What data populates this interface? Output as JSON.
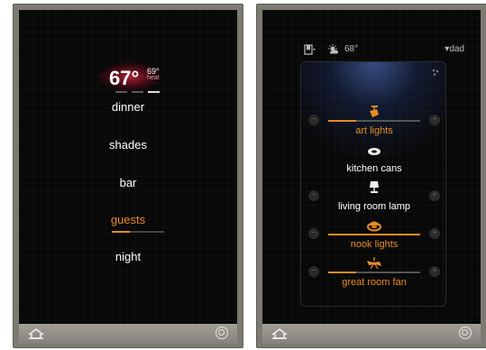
{
  "left_screen": {
    "current_temp": "67°",
    "setpoint": "69°",
    "hvac_mode": "heat",
    "scenes": [
      {
        "label": "dinner",
        "active": false
      },
      {
        "label": "shades",
        "active": false
      },
      {
        "label": "bar",
        "active": false
      },
      {
        "label": "guests",
        "active": true
      },
      {
        "label": "night",
        "active": false
      }
    ],
    "guests_level": 0.35
  },
  "right_screen": {
    "weather_temp": "68°",
    "user": "dad",
    "lights": [
      {
        "label": "art lights",
        "on": true,
        "level": 0.3,
        "icon": "spotlight-icon"
      },
      {
        "label": "kitchen cans",
        "on": false,
        "level": 0.0,
        "icon": "can-light-icon"
      },
      {
        "label": "living room lamp",
        "on": false,
        "level": 0.0,
        "icon": "table-lamp-icon"
      },
      {
        "label": "nook lights",
        "on": true,
        "level": 1.0,
        "icon": "pendant-icon"
      },
      {
        "label": "great room fan",
        "on": true,
        "level": 0.3,
        "icon": "ceiling-fan-icon"
      }
    ]
  },
  "colors": {
    "accent": "#e78b27",
    "background": "#080808",
    "frame": "#7d7a74"
  }
}
